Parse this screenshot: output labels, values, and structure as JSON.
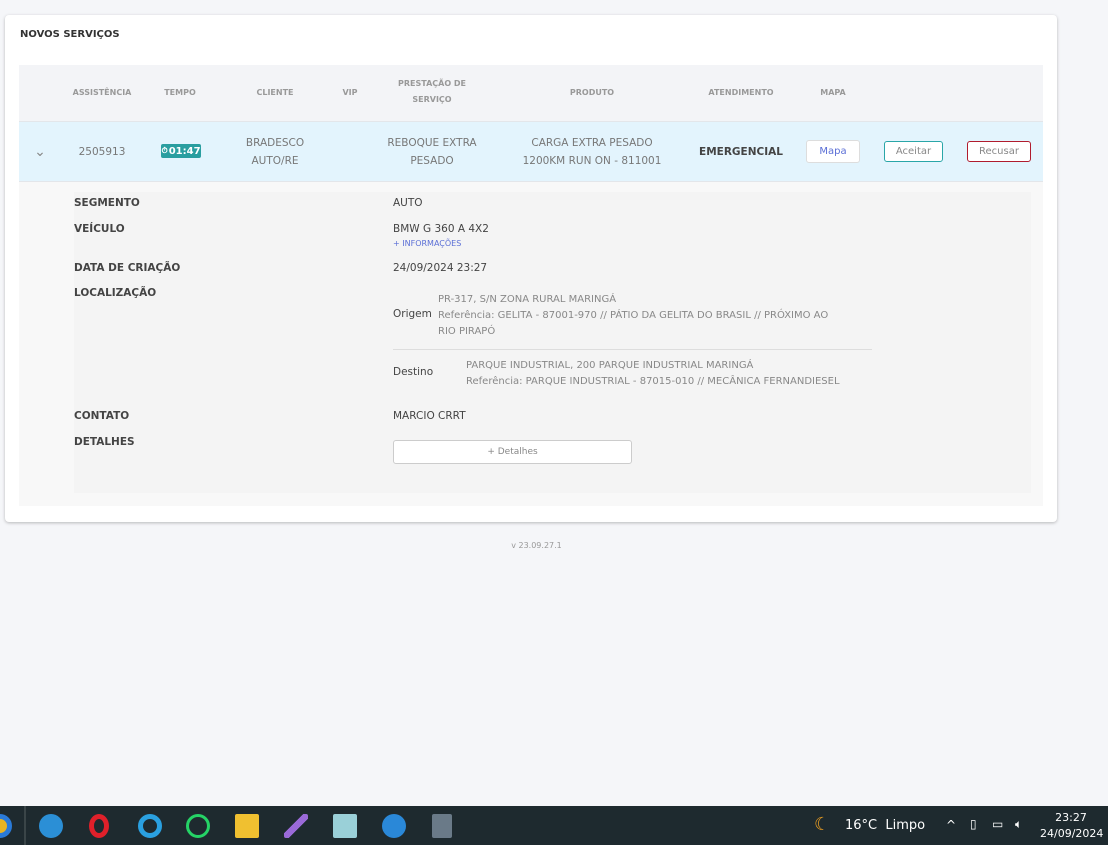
{
  "title": "NOVOS SERVIÇOS",
  "columns": {
    "assistencia": "ASSISTÊNCIA",
    "tempo": "TEMPO",
    "cliente": "CLIENTE",
    "vip": "VIP",
    "prestacao_1": "PRESTAÇÃO DE",
    "prestacao_2": "SERVIÇO",
    "produto": "PRODUTO",
    "atendimento": "ATENDIMENTO",
    "mapa": "MAPA"
  },
  "row": {
    "assistencia": "2505913",
    "tempo": "01:47",
    "cliente_1": "BRADESCO",
    "cliente_2": "AUTO/RE",
    "prestacao_1": "REBOQUE EXTRA",
    "prestacao_2": "PESADO",
    "produto_1": "CARGA EXTRA PESADO",
    "produto_2": "1200KM RUN ON - 811001",
    "atendimento": "EMERGENCIAL",
    "mapa_btn": "Mapa",
    "aceitar_btn": "Aceitar",
    "recusar_btn": "Recusar"
  },
  "details": {
    "segmento_label": "SEGMENTO",
    "segmento": "AUTO",
    "veiculo_label": "VEÍCULO",
    "veiculo": "BMW G 360 A 4X2",
    "mais_info": "+ INFORMAÇÕES",
    "data_label": "DATA DE CRIAÇÃO",
    "data": "24/09/2024 23:27",
    "localizacao_label": "LOCALIZAÇÃO",
    "origem_label": "Origem",
    "origem_1": "PR-317, S/N ZONA RURAL MARINGÁ",
    "origem_2": "Referência: GELITA - 87001-970 // PÁTIO DA GELITA DO BRASIL // PRÓXIMO AO",
    "origem_3": "RIO PIRAPÓ",
    "destino_label": "Destino",
    "destino_1": "PARQUE INDUSTRIAL, 200 PARQUE INDUSTRIAL MARINGÁ",
    "destino_2": "Referência: PARQUE INDUSTRIAL - 87015-010 // MECÂNICA FERNANDIESEL",
    "contato_label": "CONTATO",
    "contato": "MARCIO CRRT",
    "detalhes_label": "DETALHES",
    "detalhes_btn": "+ Detalhes"
  },
  "version": "v 23.09.27.1",
  "taskbar": {
    "weather": "16°C  Limpo",
    "time": "23:27",
    "date": "24/09/2024"
  }
}
